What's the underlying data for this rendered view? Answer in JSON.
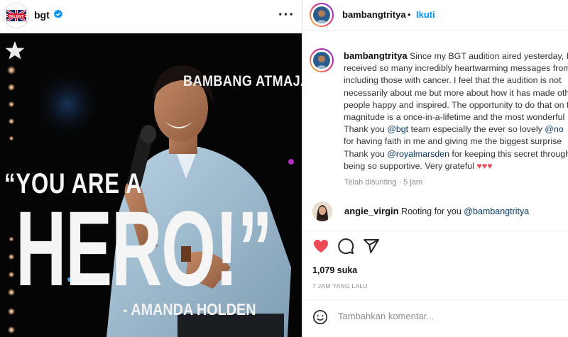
{
  "post_header": {
    "account_name": "bgt",
    "verified": true,
    "more_icon": "more-horizontal-icon",
    "avatar_logo_text": "TALENT"
  },
  "post_image": {
    "contestant_name": "BAMBANG ATMAJA",
    "quote_line1": "“YOU ARE A",
    "quote_line2": "HERO!”",
    "attribution": "- AMANDA HOLDEN",
    "star_icon": "star-icon"
  },
  "author_header": {
    "username": "bambangtritya",
    "dot": "•",
    "follow_label": "Ikuti"
  },
  "caption": {
    "username": "bambangtritya",
    "line1_text": " Since my BGT audition aired yesterday, I",
    "line2": "received so many incredibly heartwarming messages from",
    "line3": "including those with cancer. I feel that the audition is not",
    "line4": "necessarily about me but more about how it has made other",
    "line5": "people happy and inspired. The opportunity to do that on this",
    "line6": "magnitude is a once-in-a-lifetime and the most wonderful",
    "line7_pre": "Thank you ",
    "line7_link1": "@bgt",
    "line7_mid": " team especially the ever so lovely ",
    "line7_link2": "@no",
    "line8": "for having faith in me and giving me the biggest surprise",
    "line9_pre": "Thank you ",
    "line9_link": "@royalmarsden",
    "line9_post": " for keeping this secret throughout",
    "line10_text": "being so supportive. Very grateful ",
    "hearts": "♥♥♥",
    "edited": "Telah disunting · 5 jam"
  },
  "comment": {
    "username": "angie_virgin",
    "text": " Rooting for you ",
    "mention": "@bambangtritya"
  },
  "actions": {
    "like_icon": "heart-filled-icon",
    "comment_icon": "comment-icon",
    "share_icon": "share-icon",
    "liked": true,
    "like_color": "#ed4956"
  },
  "likes": "1,079 suka",
  "timestamp": "7 JAM YANG LALU",
  "add_comment": {
    "emoji_icon": "emoji-icon",
    "placeholder": "Tambahkan komentar..."
  }
}
